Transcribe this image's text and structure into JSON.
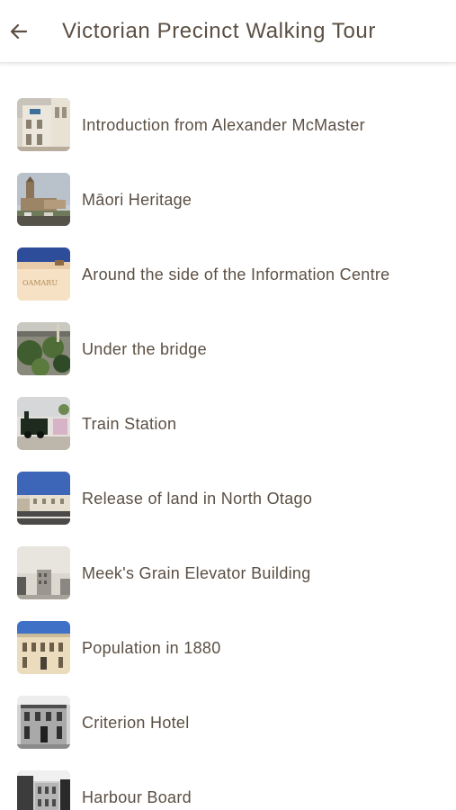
{
  "header": {
    "title": "Victorian Precinct Walking Tour",
    "back_icon": "arrow-left-icon"
  },
  "colors": {
    "text": "#5b4f43",
    "background": "#ffffff",
    "divider": "#e6e6e6"
  },
  "stops": [
    {
      "label": "Introduction from Alexander McMaster",
      "thumbnail": "heritage-building-photo"
    },
    {
      "label": "Māori Heritage",
      "thumbnail": "clock-tower-photo"
    },
    {
      "label": "Around the side of the Information Centre",
      "thumbnail": "information-centre-photo"
    },
    {
      "label": "Under the bridge",
      "thumbnail": "bridge-vegetation-photo"
    },
    {
      "label": "Train Station",
      "thumbnail": "steam-train-photo"
    },
    {
      "label": "Release of land in North Otago",
      "thumbnail": "street-buildings-photo"
    },
    {
      "label": "Meek's Grain Elevator Building",
      "thumbnail": "historic-street-photo"
    },
    {
      "label": "Population in 1880",
      "thumbnail": "stone-building-photo"
    },
    {
      "label": "Criterion Hotel",
      "thumbnail": "criterion-hotel-photo"
    },
    {
      "label": "Harbour Board",
      "thumbnail": "harbour-board-photo"
    }
  ]
}
